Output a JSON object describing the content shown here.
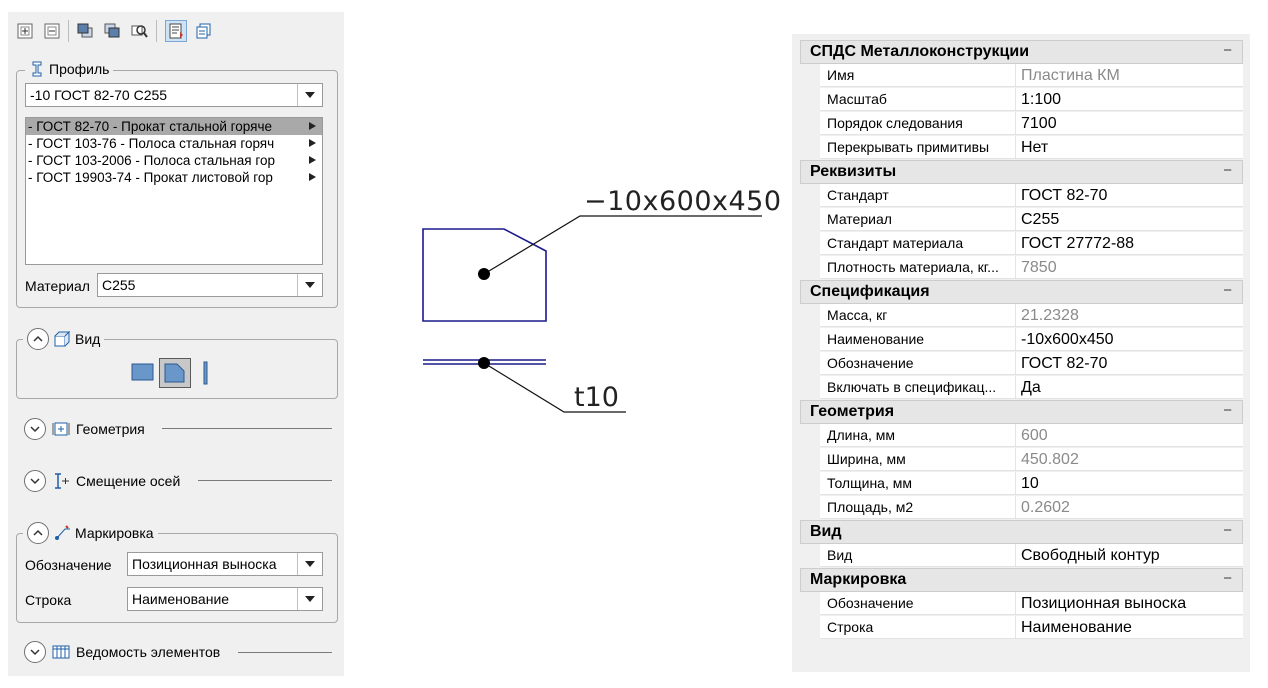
{
  "profile_group": {
    "title": "Профиль",
    "selected_profile": "-10 ГОСТ 82-70 С255",
    "standards": [
      {
        "label": "- ГОСТ 82-70 - Прокат стальной горяче",
        "selected": true
      },
      {
        "label": "- ГОСТ 103-76 - Полоса стальная горяч",
        "selected": false
      },
      {
        "label": "- ГОСТ 103-2006 - Полоса стальная гор",
        "selected": false
      },
      {
        "label": "- ГОСТ 19903-74 - Прокат листовой гор",
        "selected": false
      }
    ],
    "material_label": "Материал",
    "material_value": "С255"
  },
  "view_group": {
    "title": "Вид"
  },
  "geometry_section": {
    "title": "Геометрия"
  },
  "axes_section": {
    "title": "Смещение осей"
  },
  "marking_group": {
    "title": "Маркировка",
    "designation_label": "Обозначение",
    "designation_value": "Позиционная выноска",
    "row_label": "Строка",
    "row_value": "Наименование"
  },
  "elements_section": {
    "title": "Ведомость элементов"
  },
  "drawing": {
    "label_top": "−10x600x450",
    "label_bottom": "t10",
    "stroke_color": "#1a1a8c"
  },
  "properties": {
    "categories": [
      {
        "name": "СПДС Металлоконструкции",
        "collapse": "−",
        "rows": [
          {
            "name": "Имя",
            "value": "Пластина КМ",
            "readonly": true
          },
          {
            "name": "Масштаб",
            "value": "1:100",
            "readonly": false
          },
          {
            "name": "Порядок следования",
            "value": "7100",
            "readonly": false
          },
          {
            "name": "Перекрывать примитивы",
            "value": "Нет",
            "readonly": false
          }
        ]
      },
      {
        "name": "Реквизиты",
        "collapse": "−",
        "rows": [
          {
            "name": "Стандарт",
            "value": "ГОСТ 82-70",
            "readonly": false
          },
          {
            "name": "Материал",
            "value": "С255",
            "readonly": false
          },
          {
            "name": "Стандарт материала",
            "value": "ГОСТ 27772-88",
            "readonly": false
          },
          {
            "name": "Плотность материала, кг...",
            "value": "7850",
            "readonly": true
          }
        ]
      },
      {
        "name": "Спецификация",
        "collapse": "−",
        "rows": [
          {
            "name": "Масса, кг",
            "value": "21.2328",
            "readonly": true
          },
          {
            "name": "Наименование",
            "value": "-10x600x450",
            "readonly": false
          },
          {
            "name": "Обозначение",
            "value": "ГОСТ 82-70",
            "readonly": false
          },
          {
            "name": "Включать в спецификац...",
            "value": "Да",
            "readonly": false
          }
        ]
      },
      {
        "name": "Геометрия",
        "collapse": "−",
        "rows": [
          {
            "name": "Длина, мм",
            "value": "600",
            "readonly": true
          },
          {
            "name": "Ширина, мм",
            "value": "450.802",
            "readonly": true
          },
          {
            "name": "Толщина, мм",
            "value": "10",
            "readonly": false
          },
          {
            "name": "Площадь, м2",
            "value": "0.2602",
            "readonly": true
          }
        ]
      },
      {
        "name": "Вид",
        "collapse": "−",
        "rows": [
          {
            "name": "Вид",
            "value": "Свободный контур",
            "readonly": false
          }
        ]
      },
      {
        "name": "Маркировка",
        "collapse": "−",
        "rows": [
          {
            "name": "Обозначение",
            "value": "Позиционная выноска",
            "readonly": false
          },
          {
            "name": "Строка",
            "value": "Наименование",
            "readonly": false
          }
        ]
      }
    ]
  }
}
